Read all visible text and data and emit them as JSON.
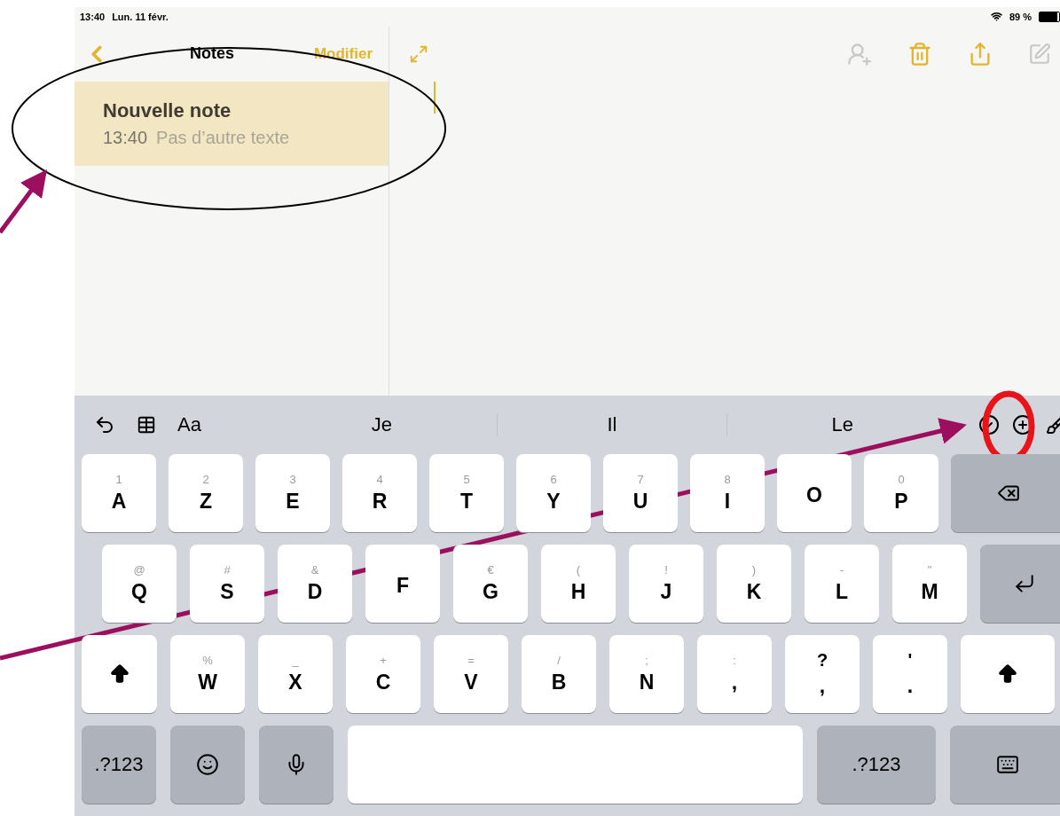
{
  "status_bar": {
    "time": "13:40",
    "date": "Lun. 11 févr.",
    "battery": "89 %"
  },
  "sidebar": {
    "title": "Notes",
    "edit_button": "Modifier",
    "notes": [
      {
        "title": "Nouvelle note",
        "time": "13:40",
        "preview": "Pas d’autre texte",
        "selected": true
      }
    ]
  },
  "keyboard": {
    "format_button": "Aa",
    "suggestions": [
      "Je",
      "Il",
      "Le"
    ],
    "rows": [
      {
        "keys": [
          {
            "kind": "letter",
            "hint": "1",
            "label": "A"
          },
          {
            "kind": "letter",
            "hint": "2",
            "label": "Z"
          },
          {
            "kind": "letter",
            "hint": "3",
            "label": "E"
          },
          {
            "kind": "letter",
            "hint": "4",
            "label": "R"
          },
          {
            "kind": "letter",
            "hint": "5",
            "label": "T"
          },
          {
            "kind": "letter",
            "hint": "6",
            "label": "Y"
          },
          {
            "kind": "letter",
            "hint": "7",
            "label": "U"
          },
          {
            "kind": "letter",
            "hint": "8",
            "label": "I"
          },
          {
            "kind": "letter",
            "label": "O"
          },
          {
            "kind": "letter",
            "hint": "0",
            "label": "P"
          },
          {
            "kind": "backspace"
          }
        ]
      },
      {
        "keys": [
          {
            "kind": "letter",
            "hint": "@",
            "label": "Q"
          },
          {
            "kind": "letter",
            "hint": "#",
            "label": "S"
          },
          {
            "kind": "letter",
            "hint": "&",
            "label": "D"
          },
          {
            "kind": "letter",
            "label": "F"
          },
          {
            "kind": "letter",
            "hint": "€",
            "label": "G"
          },
          {
            "kind": "letter",
            "hint": "(",
            "label": "H"
          },
          {
            "kind": "letter",
            "hint": "!",
            "label": "J"
          },
          {
            "kind": "letter",
            "hint": ")",
            "label": "K"
          },
          {
            "kind": "letter",
            "hint": "-",
            "label": "L"
          },
          {
            "kind": "letter",
            "hint": "\"",
            "label": "M"
          },
          {
            "kind": "return"
          }
        ]
      },
      {
        "keys": [
          {
            "kind": "shift"
          },
          {
            "kind": "letter",
            "hint": "%",
            "label": "W"
          },
          {
            "kind": "letter",
            "hint": "_",
            "label": "X"
          },
          {
            "kind": "letter",
            "hint": "+",
            "label": "C"
          },
          {
            "kind": "letter",
            "hint": "=",
            "label": "V"
          },
          {
            "kind": "letter",
            "hint": "/",
            "label": "B"
          },
          {
            "kind": "letter",
            "hint": ";",
            "label": "N"
          },
          {
            "kind": "letter",
            "hint": ":",
            "label": ","
          },
          {
            "kind": "dual",
            "hint": "?",
            "label": ","
          },
          {
            "kind": "dual",
            "hint": "'",
            "label": "."
          },
          {
            "kind": "shift"
          }
        ]
      },
      {
        "keys": [
          {
            "kind": "mode",
            "label": ".?123"
          },
          {
            "kind": "emoji"
          },
          {
            "kind": "mic"
          },
          {
            "kind": "space"
          },
          {
            "kind": "mode",
            "label": ".?123"
          },
          {
            "kind": "hide"
          }
        ]
      }
    ]
  }
}
